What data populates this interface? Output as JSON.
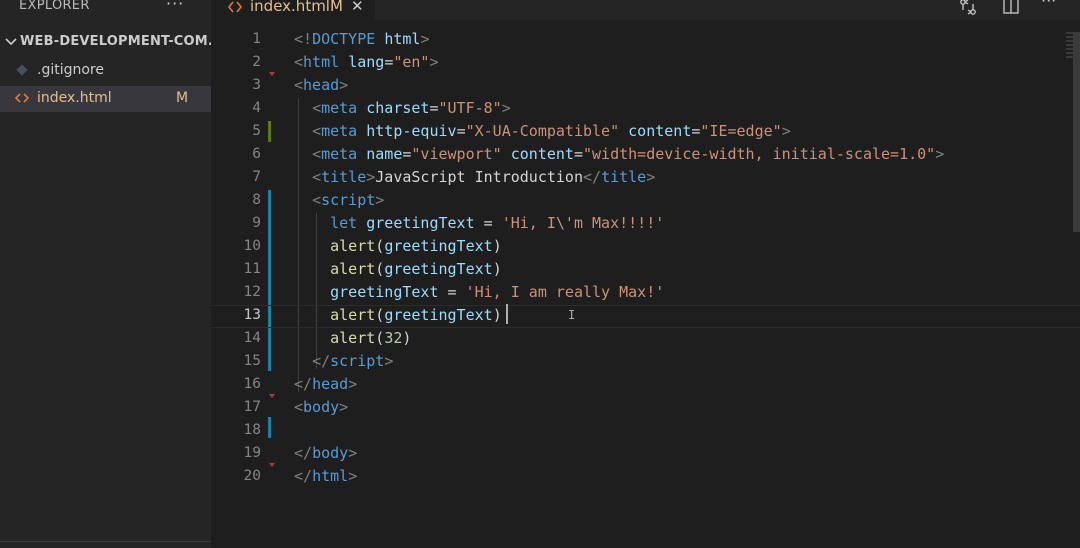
{
  "sidebar": {
    "title": "EXPLORER",
    "more_label": "···",
    "project": {
      "name": "WEB-DEVELOPMENT-COM..."
    },
    "files": [
      {
        "name": ".gitignore",
        "badge": "",
        "icon": "gitignore-icon",
        "active": false
      },
      {
        "name": "index.html",
        "badge": "M",
        "icon": "html-file-icon",
        "active": true
      }
    ]
  },
  "tabs": [
    {
      "label": "index.html",
      "badge": "M",
      "close": "✕"
    }
  ],
  "editor_actions": [
    "open-changes-icon",
    "split-editor-icon",
    "more-actions-icon"
  ],
  "more_actions_label": "···",
  "editor": {
    "current_line": 13,
    "lines": [
      {
        "n": "1",
        "tokens": [
          [
            "t",
            "<!"
          ],
          [
            "tn",
            "DOCTYPE "
          ],
          [
            "at",
            "html"
          ],
          [
            "t",
            ">"
          ]
        ]
      },
      {
        "n": "2",
        "tokens": [
          [
            "t",
            "<"
          ],
          [
            "tn",
            "html "
          ],
          [
            "at",
            "lang"
          ],
          [
            "tx",
            "="
          ],
          [
            "st",
            "\"en\""
          ],
          [
            "t",
            ">"
          ]
        ]
      },
      {
        "n": "3",
        "tokens": [
          [
            "t",
            "<"
          ],
          [
            "tn",
            "head"
          ],
          [
            "t",
            ">"
          ]
        ]
      },
      {
        "n": "4",
        "tokens": [
          [
            "tx",
            "  "
          ],
          [
            "t",
            "<"
          ],
          [
            "tn",
            "meta "
          ],
          [
            "at",
            "charset"
          ],
          [
            "tx",
            "="
          ],
          [
            "st",
            "\"UTF-8\""
          ],
          [
            "t",
            ">"
          ]
        ]
      },
      {
        "n": "5",
        "tokens": [
          [
            "tx",
            "  "
          ],
          [
            "t",
            "<"
          ],
          [
            "tn",
            "meta "
          ],
          [
            "at",
            "http-equiv"
          ],
          [
            "tx",
            "="
          ],
          [
            "st",
            "\"X-UA-Compatible\""
          ],
          [
            "tx",
            " "
          ],
          [
            "at",
            "content"
          ],
          [
            "tx",
            "="
          ],
          [
            "st",
            "\"IE=edge\""
          ],
          [
            "t",
            ">"
          ]
        ]
      },
      {
        "n": "6",
        "tokens": [
          [
            "tx",
            "  "
          ],
          [
            "t",
            "<"
          ],
          [
            "tn",
            "meta "
          ],
          [
            "at",
            "name"
          ],
          [
            "tx",
            "="
          ],
          [
            "st",
            "\"viewport\""
          ],
          [
            "tx",
            " "
          ],
          [
            "at",
            "content"
          ],
          [
            "tx",
            "="
          ],
          [
            "st",
            "\"width=device-width, initial-scale=1.0\""
          ],
          [
            "t",
            ">"
          ]
        ]
      },
      {
        "n": "7",
        "tokens": [
          [
            "tx",
            "  "
          ],
          [
            "t",
            "<"
          ],
          [
            "tn",
            "title"
          ],
          [
            "t",
            ">"
          ],
          [
            "tx",
            "JavaScript Introduction"
          ],
          [
            "t",
            "</"
          ],
          [
            "tn",
            "title"
          ],
          [
            "t",
            ">"
          ]
        ]
      },
      {
        "n": "8",
        "tokens": [
          [
            "tx",
            "  "
          ],
          [
            "t",
            "<"
          ],
          [
            "tn",
            "script"
          ],
          [
            "t",
            ">"
          ]
        ]
      },
      {
        "n": "9",
        "tokens": [
          [
            "tx",
            "    "
          ],
          [
            "kw",
            "let "
          ],
          [
            "vr",
            "greetingText"
          ],
          [
            "tx",
            " = "
          ],
          [
            "st",
            "'Hi, I\\'m Max!!!!'"
          ]
        ]
      },
      {
        "n": "10",
        "tokens": [
          [
            "tx",
            "    "
          ],
          [
            "fn",
            "alert"
          ],
          [
            "tx",
            "("
          ],
          [
            "vr",
            "greetingText"
          ],
          [
            "tx",
            ")"
          ]
        ]
      },
      {
        "n": "11",
        "tokens": [
          [
            "tx",
            "    "
          ],
          [
            "fn",
            "alert"
          ],
          [
            "tx",
            "("
          ],
          [
            "vr",
            "greetingText"
          ],
          [
            "tx",
            ")"
          ]
        ]
      },
      {
        "n": "12",
        "tokens": [
          [
            "tx",
            "    "
          ],
          [
            "vr",
            "greetingText"
          ],
          [
            "tx",
            " = "
          ],
          [
            "st",
            "'Hi, I am really Max!'"
          ]
        ]
      },
      {
        "n": "13",
        "tokens": [
          [
            "tx",
            "    "
          ],
          [
            "fn",
            "alert"
          ],
          [
            "tx",
            "("
          ],
          [
            "vr",
            "greetingText"
          ],
          [
            "tx",
            ")"
          ]
        ]
      },
      {
        "n": "14",
        "tokens": [
          [
            "tx",
            "    "
          ],
          [
            "fn",
            "alert"
          ],
          [
            "tx",
            "("
          ],
          [
            "nm",
            "32"
          ],
          [
            "tx",
            ")"
          ]
        ]
      },
      {
        "n": "15",
        "tokens": [
          [
            "tx",
            "  "
          ],
          [
            "t",
            "</"
          ],
          [
            "tn",
            "script"
          ],
          [
            "t",
            ">"
          ]
        ]
      },
      {
        "n": "16",
        "tokens": [
          [
            "t",
            "</"
          ],
          [
            "tn",
            "head"
          ],
          [
            "t",
            ">"
          ]
        ]
      },
      {
        "n": "17",
        "tokens": [
          [
            "t",
            "<"
          ],
          [
            "tn",
            "body"
          ],
          [
            "t",
            ">"
          ]
        ]
      },
      {
        "n": "18",
        "tokens": []
      },
      {
        "n": "19",
        "tokens": [
          [
            "t",
            "</"
          ],
          [
            "tn",
            "body"
          ],
          [
            "t",
            ">"
          ]
        ]
      },
      {
        "n": "20",
        "tokens": [
          [
            "t",
            "</"
          ],
          [
            "tn",
            "html"
          ],
          [
            "t",
            ">"
          ]
        ]
      }
    ]
  },
  "colors": {
    "background": "#1e1e1e",
    "sidebar": "#252526",
    "modified": "#e2c08d",
    "gutter_added": "#587c0c",
    "gutter_modified": "#1b81a8",
    "fold_marker": "#b03a3a"
  }
}
